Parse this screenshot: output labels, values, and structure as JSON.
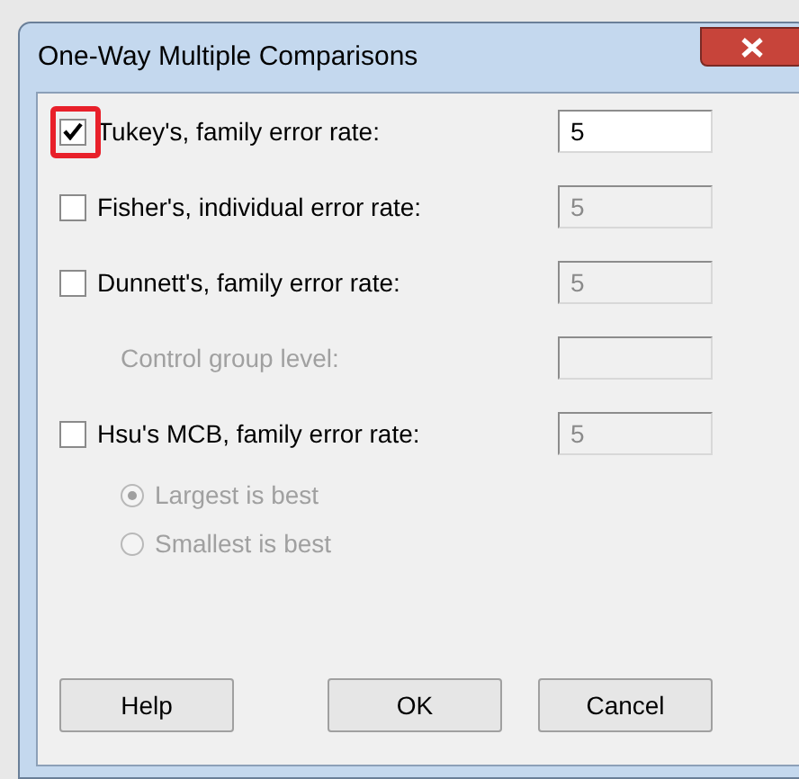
{
  "window": {
    "title": "One-Way Multiple Comparisons"
  },
  "options": [
    {
      "kind": "checkbox",
      "label": "Tukey's, family error rate:",
      "checked": true,
      "highlighted": true,
      "disabled": false,
      "field": {
        "value": "5",
        "disabled": false
      }
    },
    {
      "kind": "checkbox",
      "label": "Fisher's, individual error rate:",
      "checked": false,
      "highlighted": false,
      "disabled": false,
      "field": {
        "value": "5",
        "disabled": true
      }
    },
    {
      "kind": "checkbox",
      "label": "Dunnett's, family error rate:",
      "checked": false,
      "highlighted": false,
      "disabled": false,
      "field": {
        "value": "5",
        "disabled": true
      }
    },
    {
      "kind": "label",
      "label": "Control group level:",
      "disabled": true,
      "field": {
        "disabled": true
      }
    },
    {
      "kind": "checkbox",
      "label": "Hsu's MCB, family error rate:",
      "checked": false,
      "highlighted": false,
      "disabled": false,
      "field": {
        "value": "5",
        "disabled": true
      }
    },
    {
      "kind": "radio",
      "label": "Largest is best",
      "selected": true,
      "disabled": true
    },
    {
      "kind": "radio",
      "label": "Smallest is best",
      "selected": false,
      "disabled": true
    }
  ],
  "buttons": [
    {
      "label": "Help",
      "kind": "left"
    },
    {
      "label": "OK",
      "kind": "right"
    },
    {
      "label": "Cancel",
      "kind": "right"
    }
  ]
}
